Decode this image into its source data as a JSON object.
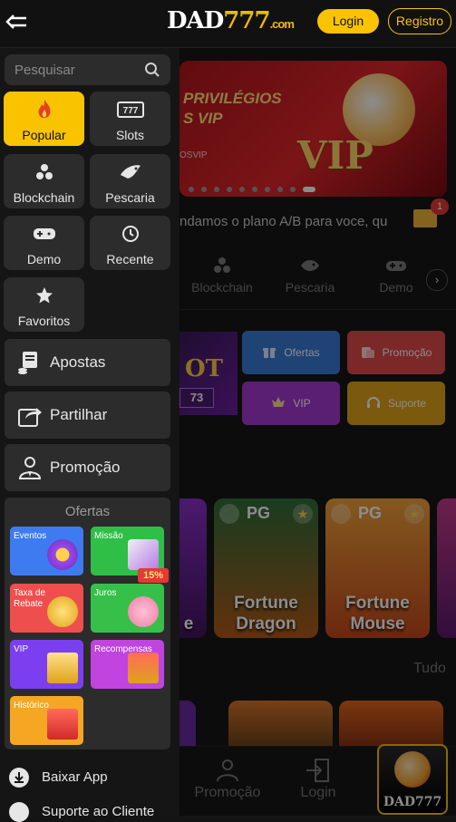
{
  "header": {
    "logo_main": "DAD",
    "logo_num": "777",
    "logo_suffix": ".com",
    "login_label": "Login",
    "register_label": "Registro"
  },
  "sidebar": {
    "search_placeholder": "Pesquisar",
    "categories": [
      {
        "label": "Popular",
        "icon": "flame-icon",
        "active": true
      },
      {
        "label": "Slots",
        "icon": "slot-machine-icon"
      },
      {
        "label": "Blockchain",
        "icon": "blockchain-icon"
      },
      {
        "label": "Pescaria",
        "icon": "fish-icon"
      },
      {
        "label": "Demo",
        "icon": "gamepad-icon"
      },
      {
        "label": "Recente",
        "icon": "history-icon"
      },
      {
        "label": "Favoritos",
        "icon": "star-icon"
      }
    ],
    "menu": [
      {
        "label": "Apostas",
        "icon": "bet-icon"
      },
      {
        "label": "Partilhar",
        "icon": "share-icon"
      },
      {
        "label": "Promoção",
        "icon": "people-icon"
      }
    ],
    "offers_title": "Ofertas",
    "offers": [
      {
        "label": "Eventos",
        "color": "#3f7bf0"
      },
      {
        "label": "Missão",
        "color": "#2fbf46",
        "badge": "15%"
      },
      {
        "label": "Taxa de Rebate",
        "color": "#ef4e4e"
      },
      {
        "label": "Juros",
        "color": "#36c04a"
      },
      {
        "label": "VIP",
        "color": "#7b3ff0"
      },
      {
        "label": "Recompensas",
        "color": "#c044e0"
      },
      {
        "label": "Histórico",
        "color": "#f5a623"
      }
    ],
    "footer": [
      {
        "label": "Baixar App",
        "icon": "download-icon"
      },
      {
        "label": "Suporte ao Cliente",
        "icon": "support-icon"
      }
    ]
  },
  "main": {
    "banner": {
      "line1": "PRIVILÉGIOS",
      "line2": "S VIP",
      "line3": "OSVIP",
      "vip": "VIP"
    },
    "marquee": "ndamos o plano A/B para voce, qu",
    "mail_count": "1",
    "tabs": [
      {
        "label": "Blockchain",
        "icon": "blockchain-icon"
      },
      {
        "label": "Pescaria",
        "icon": "fish-icon"
      },
      {
        "label": "Demo",
        "icon": "gamepad-icon"
      }
    ],
    "promo_slot_text": "OT",
    "promo_slot_number": "73",
    "quick_buttons": [
      {
        "label": "Ofertas",
        "color": "#3a7bd5",
        "icon": "gift-icon"
      },
      {
        "label": "Promoção",
        "color": "#e04a4a",
        "icon": "cash-icon"
      },
      {
        "label": "VIP",
        "color": "#a43ad1",
        "icon": "crown-icon"
      },
      {
        "label": "Suporte",
        "color": "#e0a21a",
        "icon": "headset-icon"
      }
    ],
    "games": [
      {
        "title": "e",
        "brand": ""
      },
      {
        "title": "Fortune Dragon",
        "brand": "PG"
      },
      {
        "title": "Fortune Mouse",
        "brand": "PG"
      }
    ],
    "see_all": "Tudo",
    "bottom_nav": [
      {
        "label": "Promoção",
        "icon": "people-icon"
      },
      {
        "label": "Login",
        "icon": "login-icon"
      }
    ],
    "app_badge_label": "DAD777"
  }
}
